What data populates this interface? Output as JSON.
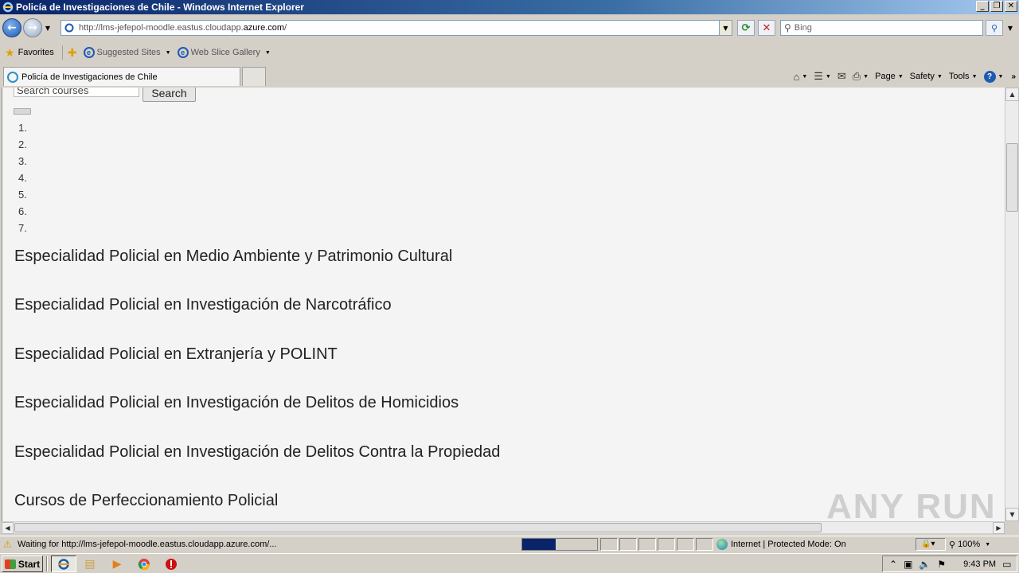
{
  "window": {
    "title": "Policía de Investigaciones de Chile - Windows Internet Explorer"
  },
  "nav": {
    "url_prefix": "http://lms-jefepol-moodle.eastus.cloudapp.",
    "url_domain": "azure.com",
    "url_suffix": "/",
    "search_placeholder": "Bing"
  },
  "favorites": {
    "label": "Favorites",
    "links": [
      {
        "label": "Suggested Sites"
      },
      {
        "label": "Web Slice Gallery"
      }
    ]
  },
  "tab": {
    "title": "Policía de Investigaciones de Chile"
  },
  "commands": {
    "page": "Page",
    "safety": "Safety",
    "tools": "Tools"
  },
  "content": {
    "search_placeholder": "Search courses",
    "search_button": "Search",
    "list_numbers": [
      "1.",
      "2.",
      "3.",
      "4.",
      "5.",
      "6.",
      "7."
    ],
    "courses": [
      "Especialidad Policial en Medio Ambiente y Patrimonio Cultural",
      "Especialidad Policial en Investigación de Narcotráfico",
      "Especialidad Policial en Extranjería y POLINT",
      "Especialidad Policial en Investigación de Delitos de Homicidios",
      "Especialidad Policial en Investigación de Delitos Contra la Propiedad",
      "Cursos de Perfeccionamiento Policial"
    ]
  },
  "watermark": "ANY RUN",
  "status": {
    "text": "Waiting for http://lms-jefepol-moodle.eastus.cloudapp.azure.com/...",
    "progress": 0.45,
    "zone": "Internet | Protected Mode: On",
    "zoom": "100%"
  },
  "taskbar": {
    "start_label": "Start",
    "clock": "9:43 PM"
  }
}
